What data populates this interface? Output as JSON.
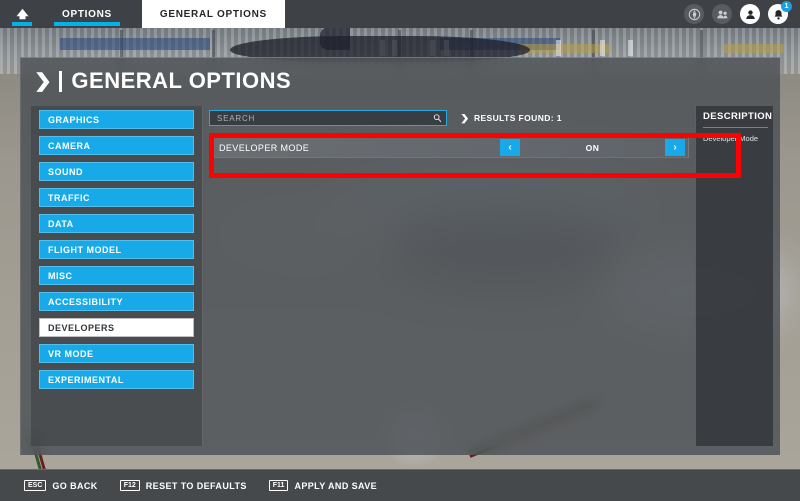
{
  "topbar": {
    "home_icon": "home-icon",
    "tabs": [
      {
        "label": "OPTIONS",
        "active": true
      },
      {
        "label": "GENERAL OPTIONS",
        "active": true
      }
    ],
    "icons": [
      {
        "name": "globe-icon",
        "badge": null
      },
      {
        "name": "friends-icon",
        "badge": null
      },
      {
        "name": "profile-icon",
        "badge": null
      },
      {
        "name": "notifications-bell-icon",
        "badge": "1"
      }
    ]
  },
  "page": {
    "title": "GENERAL OPTIONS",
    "chevron": "❯"
  },
  "sidebar": {
    "items": [
      {
        "label": "GRAPHICS"
      },
      {
        "label": "CAMERA"
      },
      {
        "label": "SOUND"
      },
      {
        "label": "TRAFFIC"
      },
      {
        "label": "DATA"
      },
      {
        "label": "FLIGHT MODEL"
      },
      {
        "label": "MISC"
      },
      {
        "label": "ACCESSIBILITY"
      },
      {
        "label": "DEVELOPERS"
      },
      {
        "label": "VR MODE"
      },
      {
        "label": "EXPERIMENTAL"
      }
    ],
    "selected_index": 8
  },
  "search": {
    "value": "",
    "placeholder": "SEARCH",
    "icon": "search-icon"
  },
  "results": {
    "chevron": "❯",
    "label": "RESULTS FOUND: 1"
  },
  "settings": [
    {
      "label": "DEVELOPER MODE",
      "value": "ON",
      "prev_arrow": "‹",
      "next_arrow": "›",
      "highlighted": true
    }
  ],
  "description": {
    "title": "DESCRIPTION",
    "text": "Developer Mode"
  },
  "bottombar": {
    "hints": [
      {
        "key": "ESC",
        "label": "GO BACK"
      },
      {
        "key": "F12",
        "label": "RESET TO DEFAULTS"
      },
      {
        "key": "F11",
        "label": "APPLY AND SAVE"
      }
    ]
  },
  "colors": {
    "accent_blue": "#17a9e8",
    "tab_underline": "#00b3ea",
    "highlight_red": "#fe0000",
    "chrome_gray": "#3e4246",
    "panel_gray": "#4a4f54"
  }
}
